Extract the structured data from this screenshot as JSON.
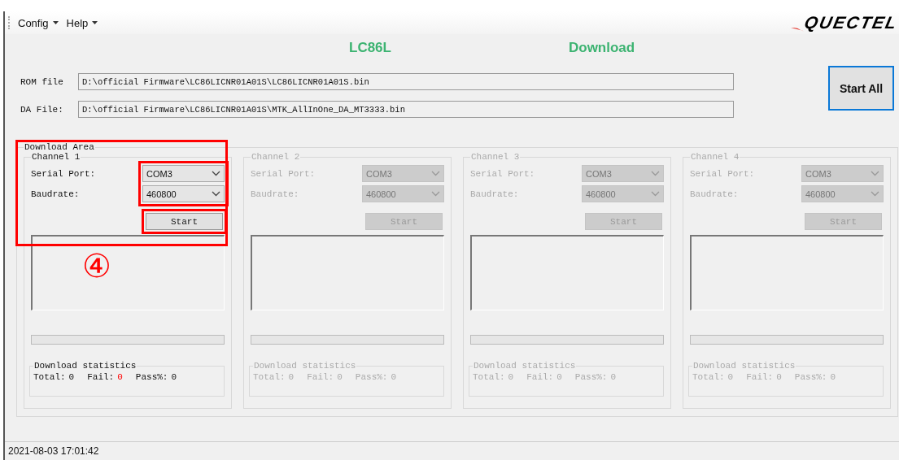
{
  "menu": [
    {
      "label": "Config"
    },
    {
      "label": "Help"
    }
  ],
  "logo": {
    "text": "QUECTEL"
  },
  "titles": {
    "model": "LC86L",
    "mode": "Download"
  },
  "files": [
    {
      "label": "ROM file",
      "value": "D:\\official Firmware\\LC86LICNR01A01S\\LC86LICNR01A01S.bin"
    },
    {
      "label": "DA File:",
      "value": "D:\\official Firmware\\LC86LICNR01A01S\\MTK_AllInOne_DA_MT3333.bin"
    }
  ],
  "start_all": "Start All",
  "download_area": {
    "title": "Download Area",
    "highlighted": true,
    "annotation": "④",
    "channels": [
      {
        "name": "Channel 1",
        "enabled": true,
        "highlighted": true,
        "port_label": "Serial Port:",
        "port": "COM3",
        "baud_label": "Baudrate:",
        "baud": "460800",
        "start": "Start",
        "level": 0,
        "stats_title": "Download statistics",
        "total_label": "Total:",
        "total": "0",
        "fail_label": "Fail:",
        "fail": "0",
        "pass_label": "Pass%:",
        "pass": "0"
      },
      {
        "name": "Channel 2",
        "enabled": false,
        "highlighted": false,
        "port_label": "Serial Port:",
        "port": "COM3",
        "baud_label": "Baudrate:",
        "baud": "460800",
        "start": "Start",
        "level": 0,
        "stats_title": "Download statistics",
        "total_label": "Total:",
        "total": "0",
        "fail_label": "Fail:",
        "fail": "0",
        "pass_label": "Pass%:",
        "pass": "0"
      },
      {
        "name": "Channel 3",
        "enabled": false,
        "highlighted": false,
        "port_label": "Serial Port:",
        "port": "COM3",
        "baud_label": "Baudrate:",
        "baud": "460800",
        "start": "Start",
        "level": 0,
        "stats_title": "Download statistics",
        "total_label": "Total:",
        "total": "0",
        "fail_label": "Fail:",
        "fail": "0",
        "pass_label": "Pass%:",
        "pass": "0"
      },
      {
        "name": "Channel 4",
        "enabled": false,
        "highlighted": false,
        "port_label": "Serial Port:",
        "port": "COM3",
        "baud_label": "Baudrate:",
        "baud": "460800",
        "start": "Start",
        "level": 0,
        "stats_title": "Download statistics",
        "total_label": "Total:",
        "total": "0",
        "fail_label": "Fail:",
        "fail": "0",
        "pass_label": "Pass%:",
        "pass": "0"
      }
    ]
  },
  "status_bar": {
    "time": "2021-08-03 17:01:42"
  }
}
